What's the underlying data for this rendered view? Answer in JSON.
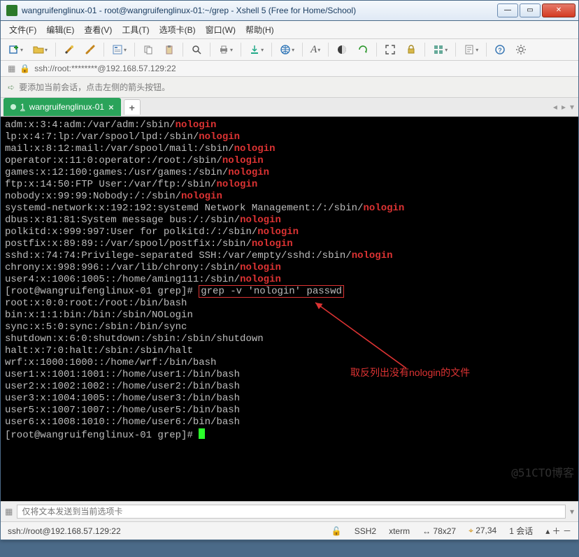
{
  "window": {
    "title": "wangruifenglinux-01 - root@wangruifenglinux-01:~/grep - Xshell 5 (Free for Home/School)"
  },
  "menu": {
    "file": "文件(F)",
    "edit": "编辑(E)",
    "view": "查看(V)",
    "tools": "工具(T)",
    "tab": "选项卡(B)",
    "window": "窗口(W)",
    "help": "帮助(H)"
  },
  "address": {
    "text": "ssh://root:********@192.168.57.129:22"
  },
  "info": {
    "text": "要添加当前会话，点击左侧的箭头按钮。"
  },
  "tabs": {
    "active": {
      "index": "1",
      "label": "wangruifenglinux-01"
    }
  },
  "terminal": {
    "lines_hl": [
      {
        "pre": "adm:x:3:4:adm:/var/adm:/sbin/",
        "hl": "nologin"
      },
      {
        "pre": "lp:x:4:7:lp:/var/spool/lpd:/sbin/",
        "hl": "nologin"
      },
      {
        "pre": "mail:x:8:12:mail:/var/spool/mail:/sbin/",
        "hl": "nologin"
      },
      {
        "pre": "operator:x:11:0:operator:/root:/sbin/",
        "hl": "nologin"
      },
      {
        "pre": "games:x:12:100:games:/usr/games:/sbin/",
        "hl": "nologin"
      },
      {
        "pre": "ftp:x:14:50:FTP User:/var/ftp:/sbin/",
        "hl": "nologin"
      },
      {
        "pre": "nobody:x:99:99:Nobody:/:/sbin/",
        "hl": "nologin"
      },
      {
        "pre": "systemd-network:x:192:192:systemd Network Management:/:/sbin/",
        "hl": "nologin"
      },
      {
        "pre": "dbus:x:81:81:System message bus:/:/sbin/",
        "hl": "nologin"
      },
      {
        "pre": "polkitd:x:999:997:User for polkitd:/:/sbin/",
        "hl": "nologin"
      },
      {
        "pre": "postfix:x:89:89::/var/spool/postfix:/sbin/",
        "hl": "nologin"
      },
      {
        "pre": "sshd:x:74:74:Privilege-separated SSH:/var/empty/sshd:/sbin/",
        "hl": "nologin"
      },
      {
        "pre": "chrony:x:998:996::/var/lib/chrony:/sbin/",
        "hl": "nologin"
      },
      {
        "pre": "user4:x:1006:1005::/home/aming111:/sbin/",
        "hl": "nologin"
      }
    ],
    "prompt1_pre": "[root@wangruifenglinux-01 grep]# ",
    "cmd": "grep -v 'nologin' passwd",
    "lines_plain": [
      "root:x:0:0:root:/root:/bin/bash",
      "bin:x:1:1:bin:/bin:/sbin/NOLogin",
      "sync:x:5:0:sync:/sbin:/bin/sync",
      "shutdown:x:6:0:shutdown:/sbin:/sbin/shutdown",
      "halt:x:7:0:halt:/sbin:/sbin/halt",
      "wrf:x:1000:1000::/home/wrf:/bin/bash",
      "user1:x:1001:1001::/home/user1:/bin/bash",
      "user2:x:1002:1002::/home/user2:/bin/bash",
      "user3:x:1004:1005::/home/user3:/bin/bash",
      "user5:x:1007:1007::/home/user5:/bin/bash",
      "user6:x:1008:1010::/home/user6:/bin/bash"
    ],
    "prompt2": "[root@wangruifenglinux-01 grep]# ",
    "annotation": "取反列出没有nologin的文件"
  },
  "sendbar": {
    "placeholder": "仅将文本发送到当前选项卡"
  },
  "status": {
    "addr": "ssh://root@192.168.57.129:22",
    "ssh": "SSH2",
    "term": "xterm",
    "size": "78x27",
    "pos": "27,34",
    "sessions": "1 会话"
  },
  "watermark": "@51CTO博客"
}
